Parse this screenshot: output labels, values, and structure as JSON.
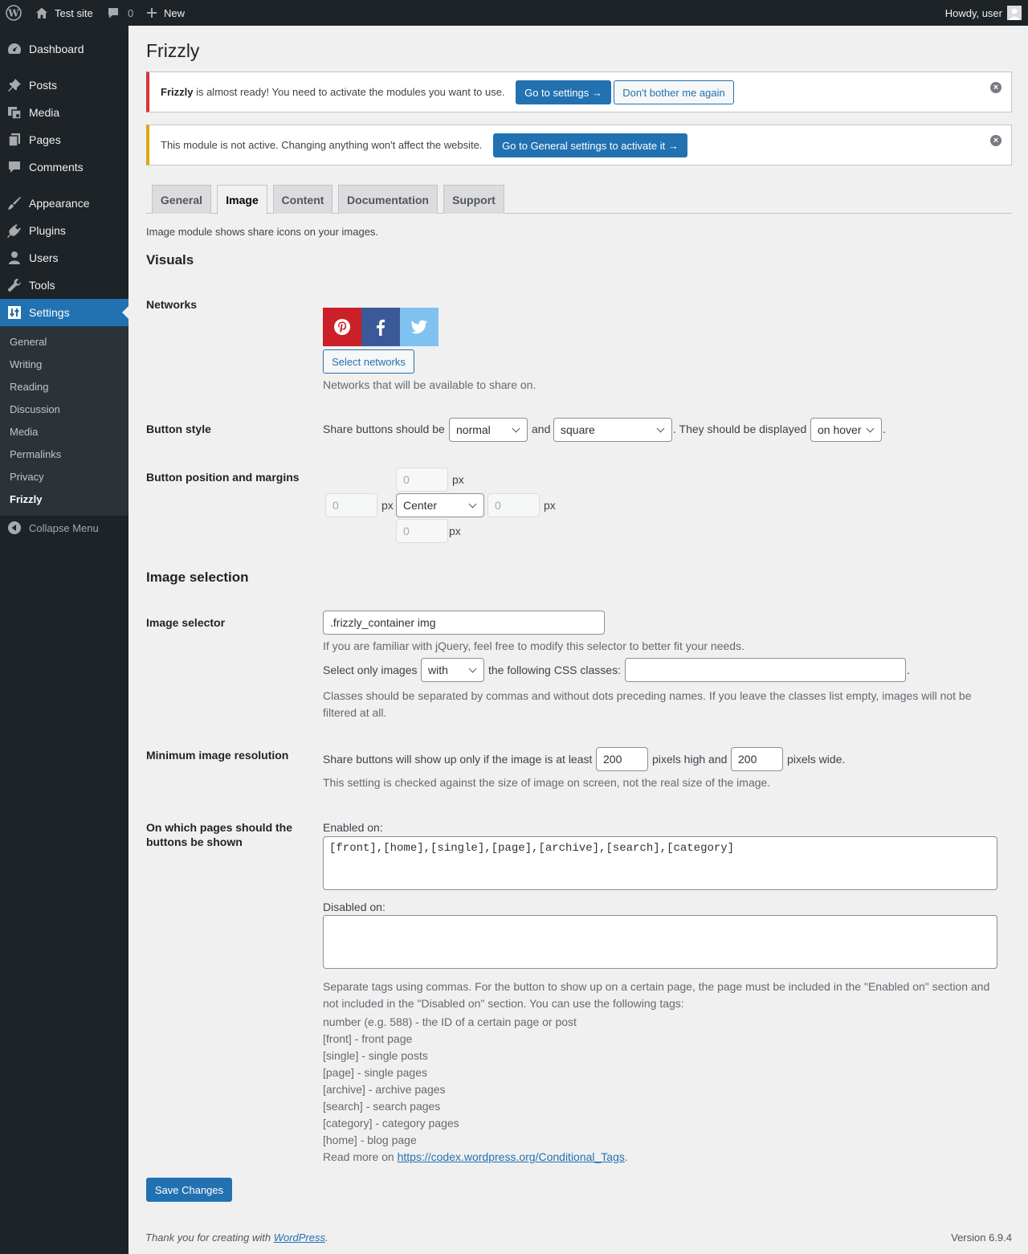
{
  "admin_bar": {
    "site_name": "Test site",
    "comments_count": "0",
    "new_label": "New",
    "howdy": "Howdy, user"
  },
  "sidebar": {
    "items": [
      {
        "label": "Dashboard",
        "icon": "dashboard-icon"
      },
      {
        "label": "Posts",
        "icon": "pin-icon"
      },
      {
        "label": "Media",
        "icon": "media-icon"
      },
      {
        "label": "Pages",
        "icon": "pages-icon"
      },
      {
        "label": "Comments",
        "icon": "comment-icon"
      },
      {
        "label": "Appearance",
        "icon": "brush-icon"
      },
      {
        "label": "Plugins",
        "icon": "plug-icon"
      },
      {
        "label": "Users",
        "icon": "user-icon"
      },
      {
        "label": "Tools",
        "icon": "wrench-icon"
      },
      {
        "label": "Settings",
        "icon": "settings-icon"
      }
    ],
    "submenu": [
      "General",
      "Writing",
      "Reading",
      "Discussion",
      "Media",
      "Permalinks",
      "Privacy",
      "Frizzly"
    ],
    "collapse_label": "Collapse Menu"
  },
  "page": {
    "title": "Frizzly"
  },
  "notice1": {
    "brand": "Frizzly",
    "text": " is almost ready! You need to activate the modules you want to use.",
    "primary_btn": "Go to settings →",
    "secondary_btn": "Don't bother me again",
    "border_color": "#d63638"
  },
  "notice2": {
    "text": "This module is not active. Changing anything won't affect the website.",
    "primary_btn": "Go to General settings to activate it →",
    "border_color": "#dba617"
  },
  "tabs": [
    "General",
    "Image",
    "Content",
    "Documentation",
    "Support"
  ],
  "active_tab": "Image",
  "intro": "Image module shows share icons on your images.",
  "visuals": {
    "heading": "Visuals",
    "networks_label": "Networks",
    "networks": [
      {
        "name": "pinterest-icon",
        "color": "#cb2027"
      },
      {
        "name": "facebook-icon",
        "color": "#3b5998"
      },
      {
        "name": "twitter-icon",
        "color": "#7fc2f0"
      }
    ],
    "select_networks_btn": "Select networks",
    "networks_desc": "Networks that will be available to share on.",
    "button_style_label": "Button style",
    "style_text1": "Share buttons should be",
    "style_size": "normal",
    "style_and": "and",
    "style_shape": "square",
    "style_text2": ". They should be displayed",
    "style_display": "on hover",
    "style_end": ".",
    "position_label": "Button position and margins",
    "margin_top": "0",
    "margin_left": "0",
    "margin_right": "0",
    "margin_bottom": "0",
    "px": "px",
    "position": "Center"
  },
  "image_selection": {
    "heading": "Image selection",
    "selector_label": "Image selector",
    "selector_value": ".frizzly_container img",
    "selector_desc": "If you are familiar with jQuery, feel free to modify this selector to better fit your needs.",
    "select_only": "Select only images",
    "with_value": "with",
    "following_classes": "the following CSS classes:",
    "classes_value": "",
    "classes_end": ".",
    "classes_desc": "Classes should be separated by commas and without dots preceding names. If you leave the classes list empty, images will not be filtered at all.",
    "min_res_label": "Minimum image resolution",
    "min_res_text1": "Share buttons will show up only if the image is at least",
    "min_height": "200",
    "min_res_text2": "pixels high and",
    "min_width": "200",
    "min_res_text3": "pixels wide.",
    "min_res_desc": "This setting is checked against the size of image on screen, not the real size of the image.",
    "pages_label": "On which pages should the buttons be shown",
    "enabled_label": "Enabled on:",
    "enabled_value": "[front],[home],[single],[page],[archive],[search],[category]",
    "disabled_label": "Disabled on:",
    "disabled_value": "",
    "tags_desc": "Separate tags using commas. For the button to show up on a certain page, the page must be included in the \"Enabled on\" section and not included in the \"Disabled on\" section. You can use the following tags:",
    "tags": [
      "number (e.g. 588) - the ID of a certain page or post",
      "[front] - front page",
      "[single] - single posts",
      "[page] - single pages",
      "[archive] - archive pages",
      "[search] - search pages",
      "[category] - category pages",
      "[home] - blog page"
    ],
    "read_more": "Read more on ",
    "read_more_link": "https://codex.wordpress.org/Conditional_Tags",
    "read_more_end": "."
  },
  "save_btn": "Save Changes",
  "footer": {
    "thanks": "Thank you for creating with ",
    "wp_link": "WordPress",
    "thanks_end": ".",
    "version": "Version 6.9.4"
  }
}
